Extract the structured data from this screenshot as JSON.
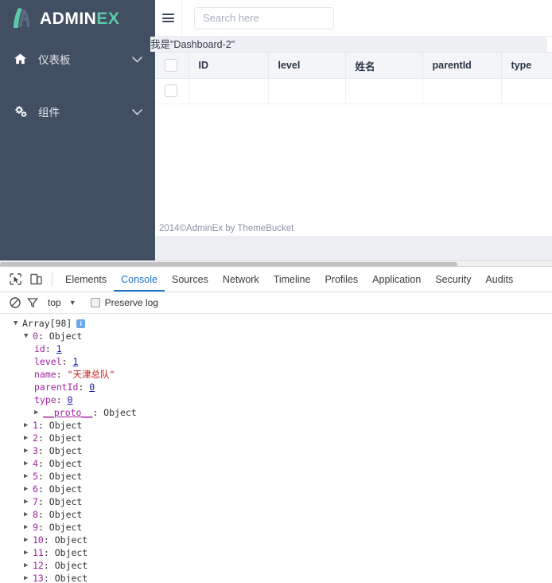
{
  "sidebar": {
    "logo": {
      "text_primary": "ADMIN",
      "text_accent": "EX",
      "accent_color": "#5cc9a7"
    },
    "items": [
      {
        "label": "仪表板",
        "icon": "home-icon"
      },
      {
        "label": "组件",
        "icon": "gears-icon"
      }
    ]
  },
  "topbar": {
    "menu_toggle": "hamburger-icon",
    "search": {
      "placeholder": "Search here",
      "value": ""
    }
  },
  "main": {
    "note": "我是\"Dashboard-2\"",
    "table": {
      "columns": [
        "ID",
        "level",
        "姓名",
        "parentId",
        "type"
      ],
      "rows": [
        {
          "cells": [
            "",
            "",
            "",
            "",
            ""
          ]
        }
      ]
    },
    "footer": "2014©AdminEx by ThemeBucket"
  },
  "devtools": {
    "tools": [
      "inspect-element-icon",
      "device-toolbar-icon"
    ],
    "tabs": [
      {
        "label": "Elements",
        "active": false
      },
      {
        "label": "Console",
        "active": true
      },
      {
        "label": "Sources",
        "active": false
      },
      {
        "label": "Network",
        "active": false
      },
      {
        "label": "Timeline",
        "active": false
      },
      {
        "label": "Profiles",
        "active": false
      },
      {
        "label": "Application",
        "active": false
      },
      {
        "label": "Security",
        "active": false
      },
      {
        "label": "Audits",
        "active": false
      }
    ],
    "filterbar": {
      "clear_icon": "clear-console-icon",
      "filter_icon": "filter-icon",
      "context": "top",
      "caret": "▼",
      "preserve_log_label": "Preserve log",
      "preserve_log_checked": false
    },
    "console": {
      "root_label": "Array[98]",
      "info_badge": "i",
      "expanded_entry": {
        "index_label": "0",
        "type_label": "Object",
        "props": [
          {
            "key": "id",
            "value": "1",
            "kind": "number"
          },
          {
            "key": "level",
            "value": "1",
            "kind": "number"
          },
          {
            "key": "name",
            "value": "\"天津总队\"",
            "kind": "string"
          },
          {
            "key": "parentId",
            "value": "0",
            "kind": "number"
          },
          {
            "key": "type",
            "value": "0",
            "kind": "number"
          }
        ],
        "proto_key": "__proto__",
        "proto_value": "Object"
      },
      "collapsed_entries": [
        {
          "index_label": "1",
          "type_label": "Object"
        },
        {
          "index_label": "2",
          "type_label": "Object"
        },
        {
          "index_label": "3",
          "type_label": "Object"
        },
        {
          "index_label": "4",
          "type_label": "Object"
        },
        {
          "index_label": "5",
          "type_label": "Object"
        },
        {
          "index_label": "6",
          "type_label": "Object"
        },
        {
          "index_label": "7",
          "type_label": "Object"
        },
        {
          "index_label": "8",
          "type_label": "Object"
        },
        {
          "index_label": "9",
          "type_label": "Object"
        },
        {
          "index_label": "10",
          "type_label": "Object"
        },
        {
          "index_label": "11",
          "type_label": "Object"
        },
        {
          "index_label": "12",
          "type_label": "Object"
        },
        {
          "index_label": "13",
          "type_label": "Object"
        }
      ]
    }
  }
}
